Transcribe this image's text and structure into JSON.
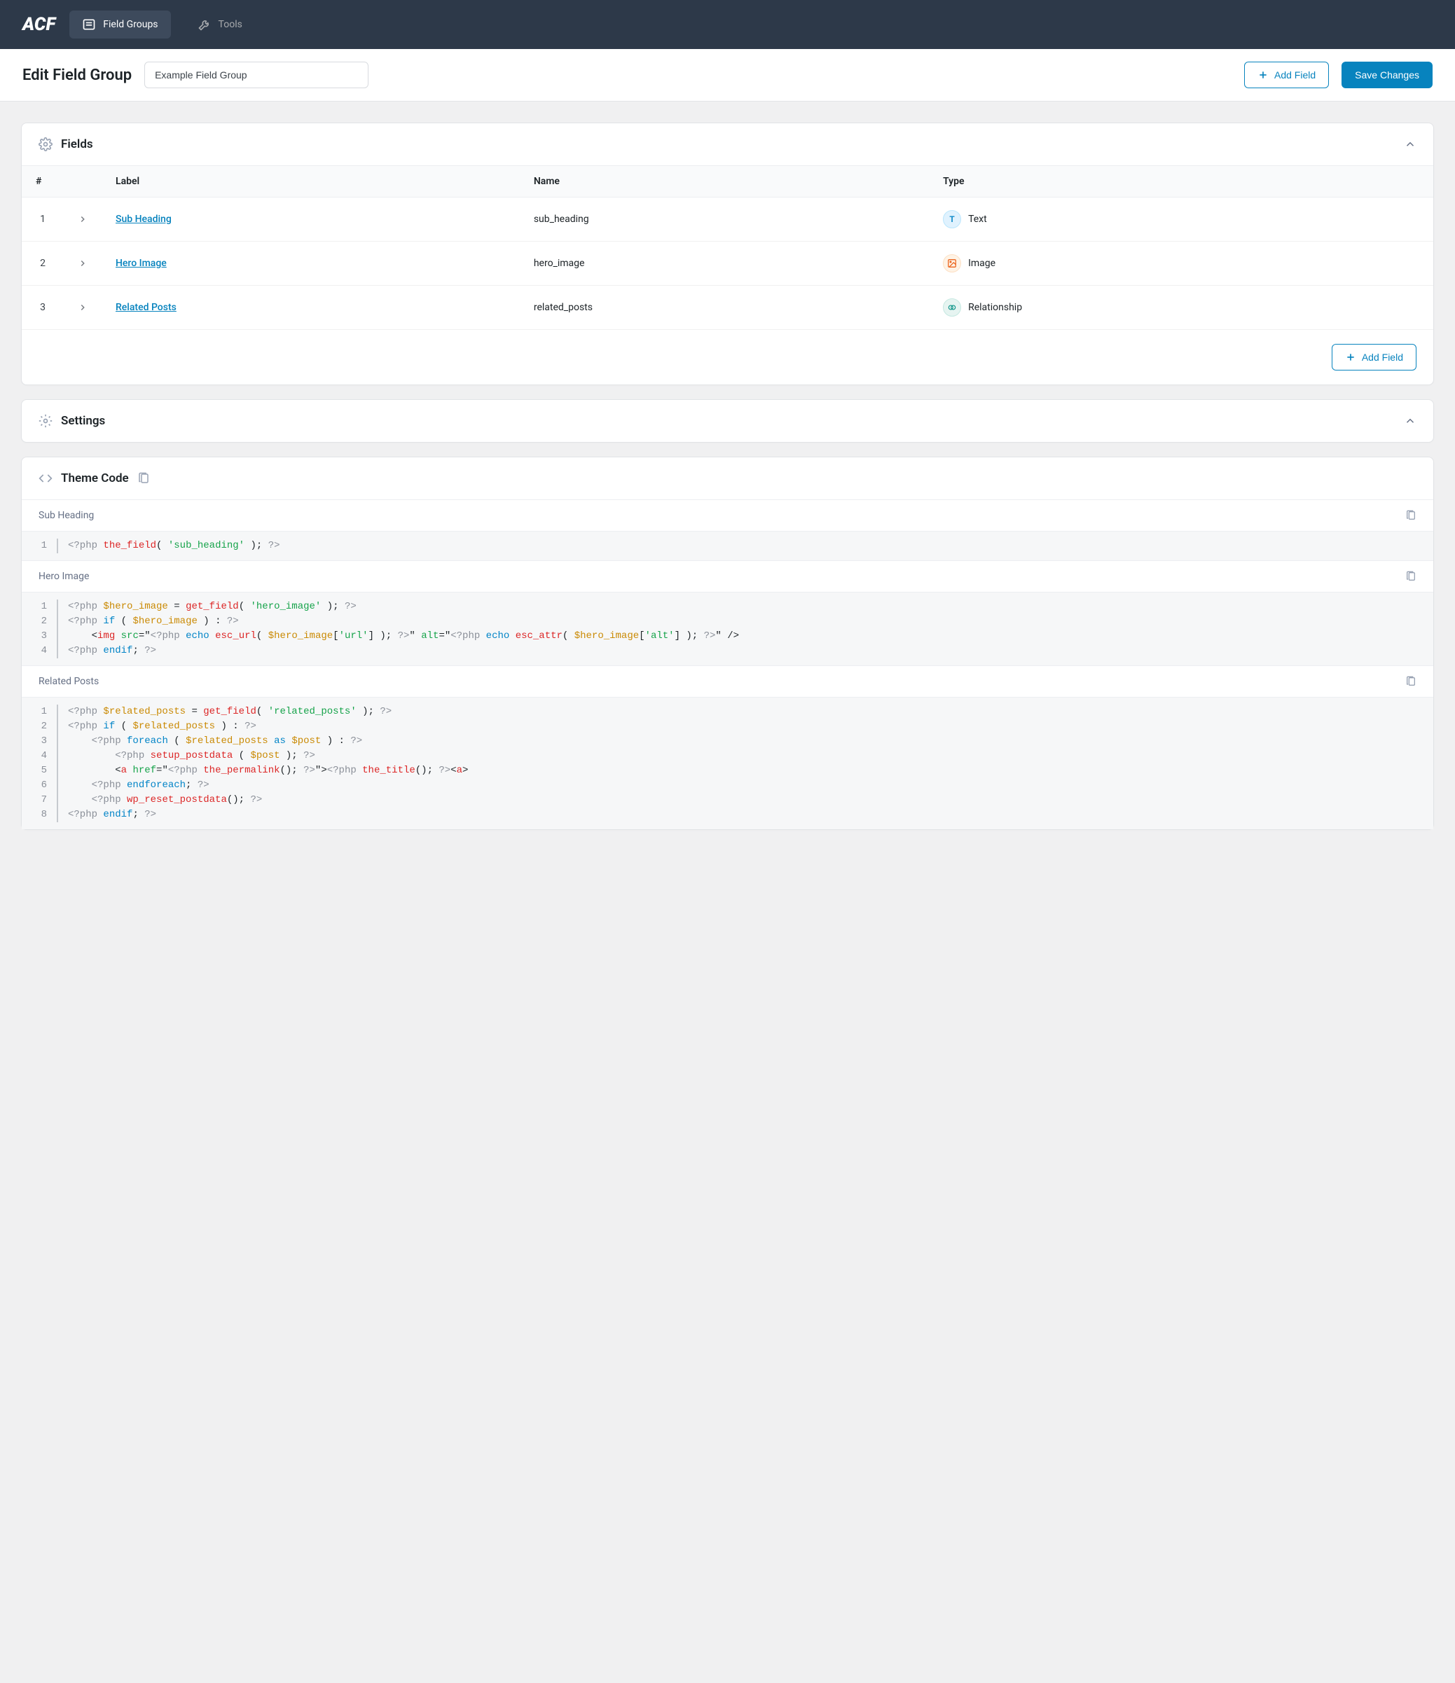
{
  "brand": "ACF",
  "nav": {
    "field_groups": "Field Groups",
    "tools": "Tools"
  },
  "header": {
    "title": "Edit Field Group",
    "title_input_value": "Example Field Group",
    "add_field": "Add Field",
    "save_changes": "Save Changes"
  },
  "fields_panel": {
    "title": "Fields",
    "columns": {
      "num": "#",
      "label": "Label",
      "name": "Name",
      "type": "Type"
    },
    "rows": [
      {
        "num": "1",
        "label": "Sub Heading",
        "name": "sub_heading",
        "type": "Text",
        "badge": "T"
      },
      {
        "num": "2",
        "label": "Hero Image",
        "name": "hero_image",
        "type": "Image",
        "badge": ""
      },
      {
        "num": "3",
        "label": "Related Posts",
        "name": "related_posts",
        "type": "Relationship",
        "badge": ""
      }
    ],
    "footer_add": "Add Field"
  },
  "settings_panel": {
    "title": "Settings"
  },
  "theme_code_panel": {
    "title": "Theme Code",
    "blocks": [
      {
        "title": "Sub Heading",
        "lines": [
          "<?php the_field( 'sub_heading' ); ?>"
        ]
      },
      {
        "title": "Hero Image",
        "lines": [
          "<?php $hero_image = get_field( 'hero_image' ); ?>",
          "<?php if ( $hero_image ) : ?>",
          "    <img src=\"<?php echo esc_url( $hero_image['url'] ); ?>\" alt=\"<?php echo esc_attr( $hero_image['alt'] ); ?>\" />",
          "<?php endif; ?>"
        ]
      },
      {
        "title": "Related Posts",
        "lines": [
          "<?php $related_posts = get_field( 'related_posts' ); ?>",
          "<?php if ( $related_posts ) : ?>",
          "    <?php foreach ( $related_posts as $post ) : ?>",
          "        <?php setup_postdata ( $post ); ?>",
          "        <a href=\"<?php the_permalink(); ?>\"><?php the_title(); ?></a>",
          "    <?php endforeach; ?>",
          "    <?php wp_reset_postdata(); ?>",
          "<?php endif; ?>"
        ]
      }
    ]
  }
}
